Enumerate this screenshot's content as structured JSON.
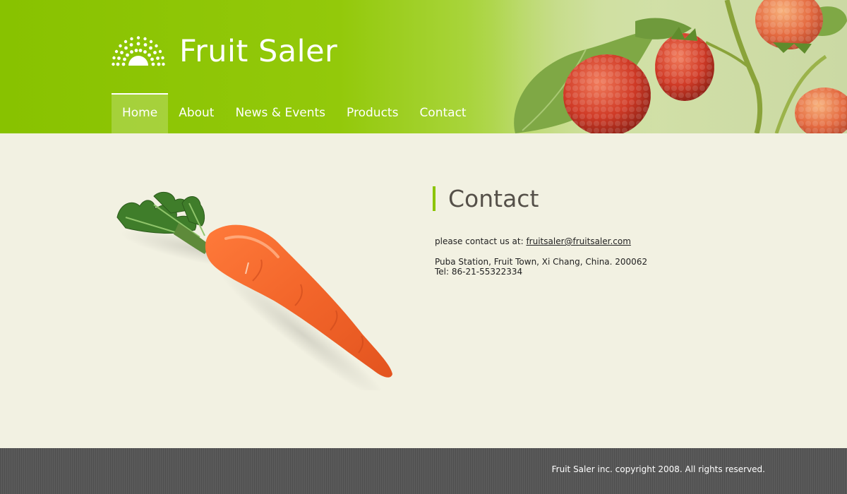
{
  "brand": {
    "name": "Fruit Saler",
    "logo_icon": "sunrise-dots-icon"
  },
  "nav": {
    "items": [
      {
        "label": "Home",
        "active": true
      },
      {
        "label": "About",
        "active": false
      },
      {
        "label": "News & Events",
        "active": false
      },
      {
        "label": "Products",
        "active": false
      },
      {
        "label": "Contact",
        "active": false
      }
    ]
  },
  "hero_image": "raspberries-photo",
  "main": {
    "image": "carrot-photo",
    "heading": "Contact",
    "intro": "please contact us at: ",
    "email": "fruitsaler@fruitsaler.com",
    "address": "Puba Station, Fruit Town, Xi Chang, China.  200062",
    "tel": "Tel: 86-21-55322334"
  },
  "footer": {
    "copyright": "Fruit Saler inc. copyright 2008. All rights reserved."
  },
  "colors": {
    "header_green": "#88c200",
    "accent_green": "#8cc400",
    "page_bg": "#f2f1e2",
    "heading_text": "#555049",
    "footer_bg": "#555555"
  }
}
